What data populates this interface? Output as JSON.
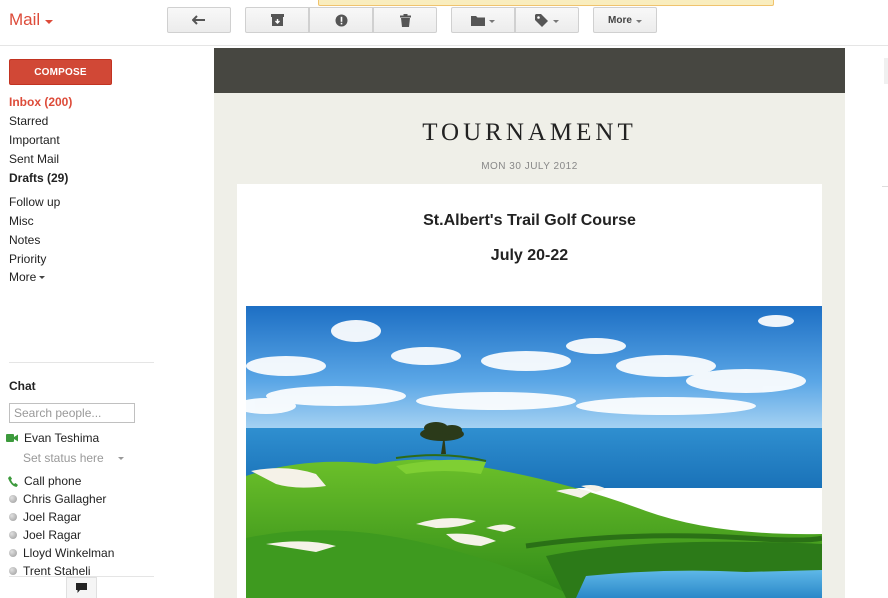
{
  "header": {
    "app_title": "Mail",
    "more_label": "More"
  },
  "toolbar": {
    "icons": [
      "reply-icon",
      "archive-icon",
      "spam-icon",
      "delete-icon",
      "folder-icon",
      "label-icon"
    ]
  },
  "sidebar": {
    "compose_label": "COMPOSE",
    "items": [
      {
        "label": "Inbox (200)"
      },
      {
        "label": "Starred"
      },
      {
        "label": "Important"
      },
      {
        "label": "Sent Mail"
      },
      {
        "label": "Drafts (29)"
      },
      {
        "label": "Follow up"
      },
      {
        "label": "Misc"
      },
      {
        "label": "Notes"
      },
      {
        "label": "Priority"
      },
      {
        "label": "More"
      }
    ]
  },
  "chat": {
    "title": "Chat",
    "search_placeholder": "Search people...",
    "me": "Evan Teshima",
    "status_text": "Set status here",
    "call_phone": "Call phone",
    "contacts": [
      {
        "name": "Chris Gallagher"
      },
      {
        "name": "Joel Ragar"
      },
      {
        "name": "Joel Ragar"
      },
      {
        "name": "Lloyd Winkelman"
      },
      {
        "name": "Trent Staheli"
      }
    ]
  },
  "message": {
    "newsletter_title": "TOURNAMENT",
    "date": "MON 30 JULY 2012",
    "venue": "St.Albert's Trail Golf Course",
    "dates": "July 20-22"
  },
  "colors": {
    "brand_red": "#dd4b39",
    "compose_red": "#d14836",
    "header_dark": "#474741",
    "newsletter_bg": "#efefe8"
  }
}
